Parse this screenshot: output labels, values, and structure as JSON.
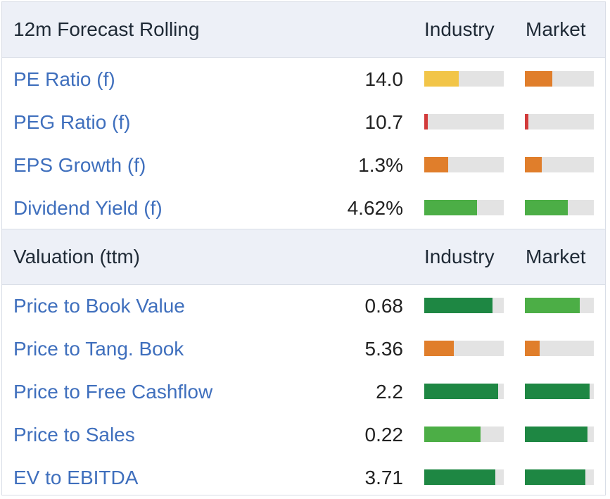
{
  "colors": {
    "yellow": "#f2c548",
    "orange": "#e07e2b",
    "red": "#d23a3a",
    "light_green": "#4cae46",
    "dark_green": "#1e8743",
    "track": "#e3e3e3",
    "label_blue": "#3f6fbd",
    "header_bg": "#edf0f7"
  },
  "sections": [
    {
      "title": "12m Forecast Rolling",
      "industry_label": "Industry",
      "market_label": "Market",
      "rows": [
        {
          "label": "PE Ratio (f)",
          "value": "14.0",
          "industry": {
            "pct": 0.43,
            "color": "#f2c548"
          },
          "market": {
            "pct": 0.4,
            "color": "#e07e2b"
          }
        },
        {
          "label": "PEG Ratio (f)",
          "value": "10.7",
          "industry": {
            "pct": 0.04,
            "color": "#d23a3a"
          },
          "market": {
            "pct": 0.05,
            "color": "#d23a3a"
          }
        },
        {
          "label": "EPS Growth (f)",
          "value": "1.3%",
          "industry": {
            "pct": 0.3,
            "color": "#e07e2b"
          },
          "market": {
            "pct": 0.24,
            "color": "#e07e2b"
          }
        },
        {
          "label": "Dividend Yield (f)",
          "value": "4.62%",
          "industry": {
            "pct": 0.66,
            "color": "#4cae46"
          },
          "market": {
            "pct": 0.62,
            "color": "#4cae46"
          }
        }
      ]
    },
    {
      "title": "Valuation (ttm)",
      "industry_label": "Industry",
      "market_label": "Market",
      "rows": [
        {
          "label": "Price to Book Value",
          "value": "0.68",
          "industry": {
            "pct": 0.86,
            "color": "#1e8743"
          },
          "market": {
            "pct": 0.8,
            "color": "#4cae46"
          }
        },
        {
          "label": "Price to Tang. Book",
          "value": "5.36",
          "industry": {
            "pct": 0.37,
            "color": "#e07e2b"
          },
          "market": {
            "pct": 0.21,
            "color": "#e07e2b"
          }
        },
        {
          "label": "Price to Free Cashflow",
          "value": "2.2",
          "industry": {
            "pct": 0.93,
            "color": "#1e8743"
          },
          "market": {
            "pct": 0.94,
            "color": "#1e8743"
          }
        },
        {
          "label": "Price to Sales",
          "value": "0.22",
          "industry": {
            "pct": 0.71,
            "color": "#4cae46"
          },
          "market": {
            "pct": 0.91,
            "color": "#1e8743"
          }
        },
        {
          "label": "EV to EBITDA",
          "value": "3.71",
          "industry": {
            "pct": 0.89,
            "color": "#1e8743"
          },
          "market": {
            "pct": 0.88,
            "color": "#1e8743"
          }
        }
      ]
    }
  ]
}
